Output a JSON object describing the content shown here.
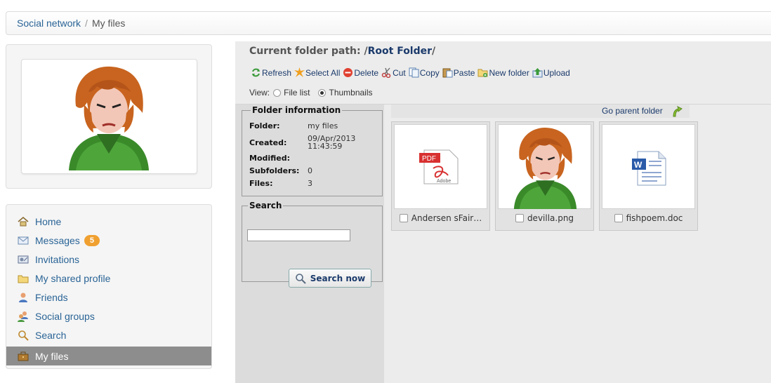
{
  "breadcrumb": {
    "root": "Social network",
    "separator": "/",
    "current": "My files"
  },
  "nav": {
    "items": [
      {
        "label": "Home",
        "icon": "home-icon"
      },
      {
        "label": "Messages",
        "icon": "envelope-icon",
        "badge": "5"
      },
      {
        "label": "Invitations",
        "icon": "invitation-icon"
      },
      {
        "label": "My shared profile",
        "icon": "folder-icon"
      },
      {
        "label": "Friends",
        "icon": "user-icon"
      },
      {
        "label": "Social groups",
        "icon": "group-icon"
      },
      {
        "label": "Search",
        "icon": "magnifier-icon"
      },
      {
        "label": "My files",
        "icon": "briefcase-icon",
        "active": true
      }
    ]
  },
  "path": {
    "label": "Current folder path:",
    "prefix": "/",
    "folder": "Root Folder",
    "suffix": "/"
  },
  "toolbar": {
    "refresh": "Refresh",
    "select_all": "Select All",
    "delete": "Delete",
    "cut": "Cut",
    "copy": "Copy",
    "paste": "Paste",
    "new_folder": "New folder",
    "upload": "Upload"
  },
  "view": {
    "label": "View:",
    "file_list": "File list",
    "thumbnails": "Thumbnails",
    "selected": "thumbnails"
  },
  "folder_info": {
    "legend": "Folder information",
    "folder_label": "Folder:",
    "folder_value": "my files",
    "created_label": "Created:",
    "created_date": "09/Apr/2013",
    "created_time": "11:43:59",
    "modified_label": "Modified:",
    "modified_value": "",
    "subfolders_label": "Subfolders:",
    "subfolders_value": "0",
    "files_label": "Files:",
    "files_value": "3"
  },
  "search": {
    "legend": "Search",
    "value": "",
    "button": "Search now"
  },
  "go_parent": "Go parent folder",
  "files": [
    {
      "name": "Andersen sFair…",
      "type": "pdf"
    },
    {
      "name": "devilla.png",
      "type": "image"
    },
    {
      "name": "fishpoem.doc",
      "type": "doc"
    }
  ],
  "colors": {
    "link": "#2a6496",
    "accent_badge": "#f0a030",
    "active_nav": "#8d8d8d",
    "panel": "#ececec"
  }
}
